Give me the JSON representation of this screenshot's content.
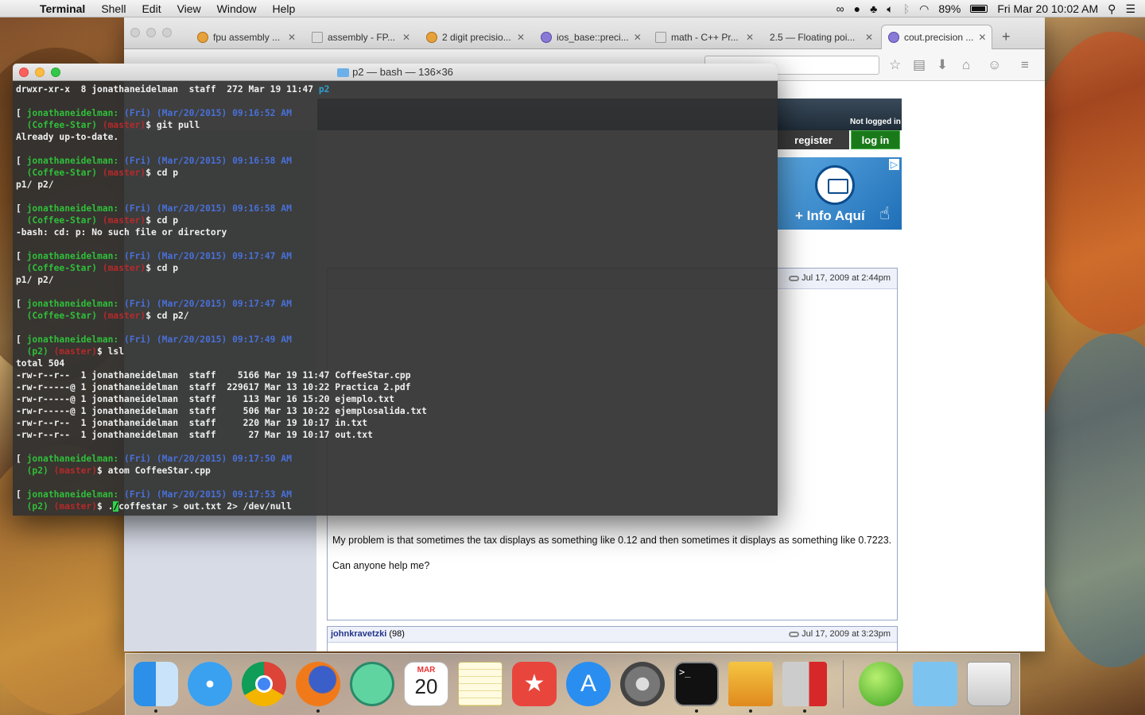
{
  "menubar": {
    "app_name": "Terminal",
    "menus": [
      "Shell",
      "Edit",
      "View",
      "Window",
      "Help"
    ],
    "battery": "89%",
    "datetime": "Fri Mar 20  10:02 AM"
  },
  "browser": {
    "tabs": [
      {
        "label": "fpu assembly ..."
      },
      {
        "label": "assembly - FP..."
      },
      {
        "label": "2 digit precisio..."
      },
      {
        "label": "ios_base::preci..."
      },
      {
        "label": "math - C++ Pr..."
      },
      {
        "label": "2.5 — Floating poi..."
      },
      {
        "label": "cout.precision ..."
      }
    ],
    "tab_close": "✕",
    "new_tab": "+",
    "page": {
      "not_logged_in": "Not logged in",
      "register": "register",
      "login": "log in",
      "ad_text": "+ Info Aquí",
      "ad_choices": "▷",
      "post1_date": "Jul 17, 2009 at 2:44pm",
      "post1_text_1": "My problem is that sometimes the tax displays as something like 0.12 and then sometimes it displays as something like 0.7223.",
      "post1_text_2": "Can anyone help me?",
      "post2_author": "johnkravetzki",
      "post2_count": "(98)",
      "post2_date": "Jul 17, 2009 at 3:23pm"
    }
  },
  "terminal": {
    "title": "p2 — bash — 136×36",
    "lines": [
      {
        "segs": [
          {
            "t": "drwxr-xr-x  8 jonathaneidelman  staff  272 Mar 19 11:47 ",
            "c": ""
          },
          {
            "t": "p2",
            "c": "dir"
          }
        ]
      },
      {
        "segs": [
          {
            "t": " ",
            "c": ""
          }
        ]
      },
      {
        "segs": [
          {
            "t": "[ ",
            "c": ""
          },
          {
            "t": "jonathaneidelman: ",
            "c": "host"
          },
          {
            "t": "(Fri) (Mar/20/2015) 09:16:52 AM",
            "c": "dt"
          }
        ]
      },
      {
        "segs": [
          {
            "t": "  (Coffee-Star) ",
            "c": "host"
          },
          {
            "t": "(master)",
            "c": "br"
          },
          {
            "t": "$ git pull",
            "c": ""
          }
        ]
      },
      {
        "segs": [
          {
            "t": "Already up-to-date.",
            "c": ""
          }
        ]
      },
      {
        "segs": [
          {
            "t": " ",
            "c": ""
          }
        ]
      },
      {
        "segs": [
          {
            "t": "[ ",
            "c": ""
          },
          {
            "t": "jonathaneidelman: ",
            "c": "host"
          },
          {
            "t": "(Fri) (Mar/20/2015) 09:16:58 AM",
            "c": "dt"
          }
        ]
      },
      {
        "segs": [
          {
            "t": "  (Coffee-Star) ",
            "c": "host"
          },
          {
            "t": "(master)",
            "c": "br"
          },
          {
            "t": "$ cd p",
            "c": ""
          }
        ]
      },
      {
        "segs": [
          {
            "t": "p1/ p2/",
            "c": ""
          }
        ]
      },
      {
        "segs": [
          {
            "t": " ",
            "c": ""
          }
        ]
      },
      {
        "segs": [
          {
            "t": "[ ",
            "c": ""
          },
          {
            "t": "jonathaneidelman: ",
            "c": "host"
          },
          {
            "t": "(Fri) (Mar/20/2015) 09:16:58 AM",
            "c": "dt"
          }
        ]
      },
      {
        "segs": [
          {
            "t": "  (Coffee-Star) ",
            "c": "host"
          },
          {
            "t": "(master)",
            "c": "br"
          },
          {
            "t": "$ cd p",
            "c": ""
          }
        ]
      },
      {
        "segs": [
          {
            "t": "-bash: cd: p: No such file or directory",
            "c": ""
          }
        ]
      },
      {
        "segs": [
          {
            "t": " ",
            "c": ""
          }
        ]
      },
      {
        "segs": [
          {
            "t": "[ ",
            "c": ""
          },
          {
            "t": "jonathaneidelman: ",
            "c": "host"
          },
          {
            "t": "(Fri) (Mar/20/2015) 09:17:47 AM",
            "c": "dt"
          }
        ]
      },
      {
        "segs": [
          {
            "t": "  (Coffee-Star) ",
            "c": "host"
          },
          {
            "t": "(master)",
            "c": "br"
          },
          {
            "t": "$ cd p",
            "c": ""
          }
        ]
      },
      {
        "segs": [
          {
            "t": "p1/ p2/",
            "c": ""
          }
        ]
      },
      {
        "segs": [
          {
            "t": " ",
            "c": ""
          }
        ]
      },
      {
        "segs": [
          {
            "t": "[ ",
            "c": ""
          },
          {
            "t": "jonathaneidelman: ",
            "c": "host"
          },
          {
            "t": "(Fri) (Mar/20/2015) 09:17:47 AM",
            "c": "dt"
          }
        ]
      },
      {
        "segs": [
          {
            "t": "  (Coffee-Star) ",
            "c": "host"
          },
          {
            "t": "(master)",
            "c": "br"
          },
          {
            "t": "$ cd p2/",
            "c": ""
          }
        ]
      },
      {
        "segs": [
          {
            "t": " ",
            "c": ""
          }
        ]
      },
      {
        "segs": [
          {
            "t": "[ ",
            "c": ""
          },
          {
            "t": "jonathaneidelman: ",
            "c": "host"
          },
          {
            "t": "(Fri) (Mar/20/2015) 09:17:49 AM",
            "c": "dt"
          }
        ]
      },
      {
        "segs": [
          {
            "t": "  (p2) ",
            "c": "host"
          },
          {
            "t": "(master)",
            "c": "br"
          },
          {
            "t": "$ lsl",
            "c": ""
          }
        ]
      },
      {
        "segs": [
          {
            "t": "total 504",
            "c": ""
          }
        ]
      },
      {
        "segs": [
          {
            "t": "-rw-r--r--  1 jonathaneidelman  staff    5166 Mar 19 11:47 CoffeeStar.cpp",
            "c": ""
          }
        ]
      },
      {
        "segs": [
          {
            "t": "-rw-r-----@ 1 jonathaneidelman  staff  229617 Mar 13 10:22 Practica 2.pdf",
            "c": ""
          }
        ]
      },
      {
        "segs": [
          {
            "t": "-rw-r-----@ 1 jonathaneidelman  staff     113 Mar 16 15:20 ejemplo.txt",
            "c": ""
          }
        ]
      },
      {
        "segs": [
          {
            "t": "-rw-r-----@ 1 jonathaneidelman  staff     506 Mar 13 10:22 ejemplosalida.txt",
            "c": ""
          }
        ]
      },
      {
        "segs": [
          {
            "t": "-rw-r--r--  1 jonathaneidelman  staff     220 Mar 19 10:17 in.txt",
            "c": ""
          }
        ]
      },
      {
        "segs": [
          {
            "t": "-rw-r--r--  1 jonathaneidelman  staff      27 Mar 19 10:17 out.txt",
            "c": ""
          }
        ]
      },
      {
        "segs": [
          {
            "t": " ",
            "c": ""
          }
        ]
      },
      {
        "segs": [
          {
            "t": "[ ",
            "c": ""
          },
          {
            "t": "jonathaneidelman: ",
            "c": "host"
          },
          {
            "t": "(Fri) (Mar/20/2015) 09:17:50 AM",
            "c": "dt"
          }
        ]
      },
      {
        "segs": [
          {
            "t": "  (p2) ",
            "c": "host"
          },
          {
            "t": "(master)",
            "c": "br"
          },
          {
            "t": "$ atom CoffeeStar.cpp",
            "c": ""
          }
        ]
      },
      {
        "segs": [
          {
            "t": " ",
            "c": ""
          }
        ]
      },
      {
        "segs": [
          {
            "t": "[ ",
            "c": ""
          },
          {
            "t": "jonathaneidelman: ",
            "c": "host"
          },
          {
            "t": "(Fri) (Mar/20/2015) 09:17:53 AM",
            "c": "dt"
          }
        ]
      },
      {
        "segs": [
          {
            "t": "  (p2) ",
            "c": "host"
          },
          {
            "t": "(master)",
            "c": "br"
          },
          {
            "t": "$ .",
            "c": ""
          },
          {
            "t": "/",
            "c": "cur"
          },
          {
            "t": "coffestar > out.txt 2> /dev/null",
            "c": ""
          }
        ]
      }
    ]
  },
  "dock": {
    "calendar_month": "MAR",
    "calendar_day": "20",
    "items": [
      "finder-icon",
      "safari-icon",
      "chrome-icon",
      "firefox-icon",
      "atom-icon",
      "calendar-icon",
      "notes-icon",
      "wunderlist-icon",
      "app-store-icon",
      "system-preferences-icon",
      "terminal-icon",
      "preview-icon",
      "parallels-icon",
      "grapher-icon",
      "downloads-folder-icon",
      "trash-icon"
    ]
  }
}
